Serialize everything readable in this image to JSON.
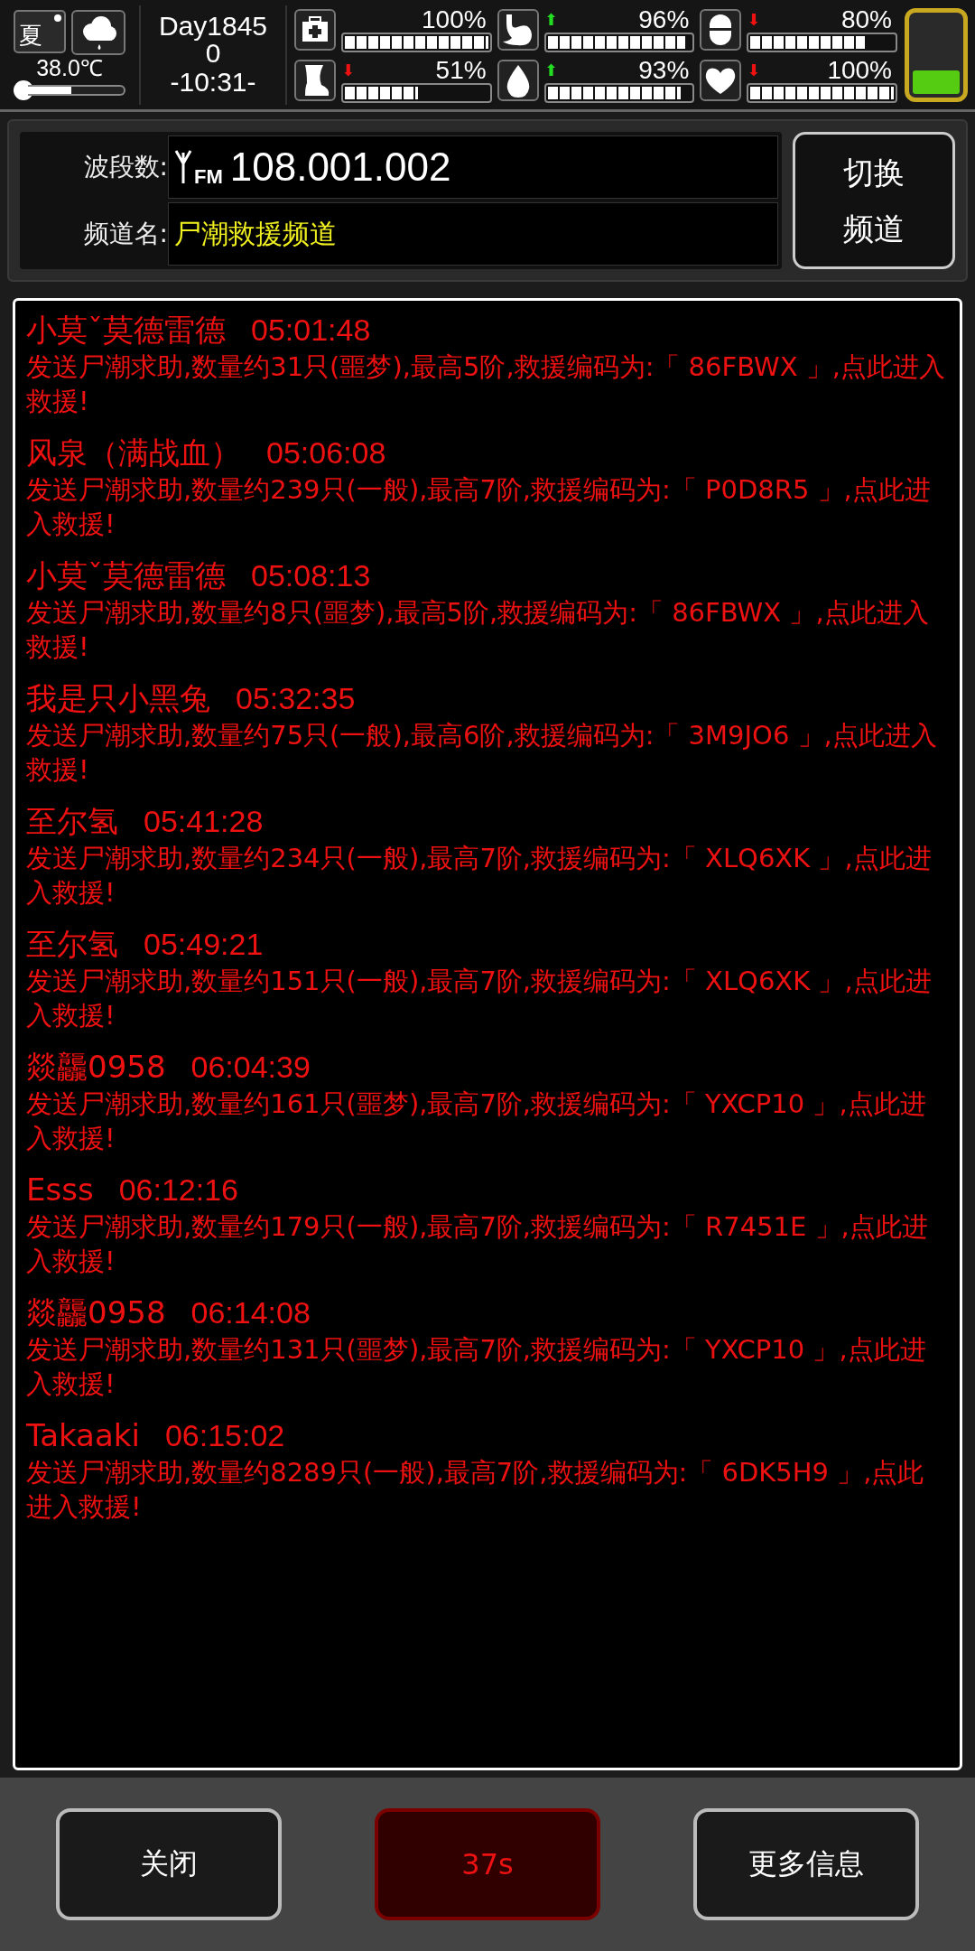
{
  "status": {
    "season": "夏",
    "temperature": "38.0℃",
    "day": "Day18450",
    "time": "-10:31-",
    "stats": [
      {
        "reading": "100%",
        "level": 1
      },
      {
        "reading": "96%",
        "level": 0.96,
        "arrow": "⬆",
        "color": "#22dd22"
      },
      {
        "reading": "80%",
        "level": 0.8,
        "arrow": "⬇",
        "color": "#ee1111"
      },
      {
        "reading": "51%",
        "level": 0.51,
        "arrow": "⬇",
        "color": "#ee1111"
      },
      {
        "reading": "93%",
        "level": 0.93,
        "arrow": "⬆",
        "color": "#22dd22"
      },
      {
        "reading": "100%",
        "level": 1,
        "arrow": "⬇",
        "color": "#ee1111"
      }
    ]
  },
  "channel": {
    "band_label": "波段数:",
    "band_badge": "FM",
    "band_value": "108.001.002",
    "name_label": "频道名:",
    "name_value": "尸潮救援频道",
    "switch_button": "切换频道"
  },
  "messages": [
    {
      "sender": "小莫ˇ莫德雷德",
      "time": "05:01:48",
      "text": "发送尸潮求助,数量约31只(噩梦),最高5阶,救援编码为:「 86FBWX 」,点此进入救援!"
    },
    {
      "sender": "风泉（满战血）",
      "time": "05:06:08",
      "text": "发送尸潮求助,数量约239只(一般),最高7阶,救援编码为:「 P0D8R5 」,点此进入救援!"
    },
    {
      "sender": "小莫ˇ莫德雷德",
      "time": "05:08:13",
      "text": "发送尸潮求助,数量约8只(噩梦),最高5阶,救援编码为:「 86FBWX 」,点此进入救援!"
    },
    {
      "sender": "我是只小黑兔",
      "time": "05:32:35",
      "text": "发送尸潮求助,数量约75只(一般),最高6阶,救援编码为:「 3M9JO6 」,点此进入救援!"
    },
    {
      "sender": "至尔氢",
      "time": "05:41:28",
      "text": "发送尸潮求助,数量约234只(一般),最高7阶,救援编码为:「 XLQ6XK 」,点此进入救援!"
    },
    {
      "sender": "至尔氢",
      "time": "05:49:21",
      "text": "发送尸潮求助,数量约151只(一般),最高7阶,救援编码为:「 XLQ6XK 」,点此进入救援!"
    },
    {
      "sender": "燚龘0958",
      "time": "06:04:39",
      "text": "发送尸潮求助,数量约161只(噩梦),最高7阶,救援编码为:「 YXCP10 」,点此进入救援!"
    },
    {
      "sender": "Esss",
      "time": "06:12:16",
      "text": "发送尸潮求助,数量约179只(一般),最高7阶,救援编码为:「 R7451E 」,点此进入救援!"
    },
    {
      "sender": "燚龘0958",
      "time": "06:14:08",
      "text": "发送尸潮求助,数量约131只(噩梦),最高7阶,救援编码为:「 YXCP10 」,点此进入救援!"
    },
    {
      "sender": "Takaaki",
      "time": "06:15:02",
      "text": "发送尸潮求助,数量约8289只(一般),最高7阶,救援编码为:「 6DK5H9 」,点此进入救援!"
    }
  ],
  "buttons": {
    "close": "关闭",
    "timer": "37s",
    "more": "更多信息"
  }
}
